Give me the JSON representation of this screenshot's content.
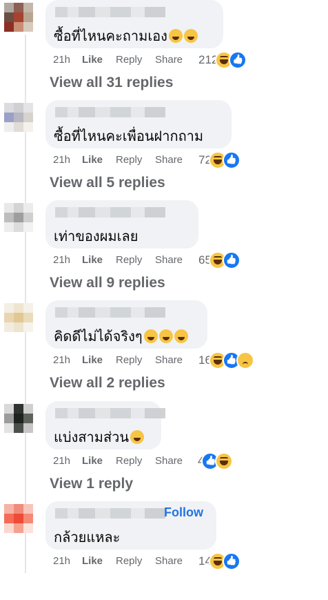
{
  "actions": {
    "time": "21h",
    "like": "Like",
    "reply": "Reply",
    "share": "Share"
  },
  "comments": [
    {
      "text": "ซื้อที่ไหนคะถามเอง",
      "emojis": [
        "laughing-crying-emoji",
        "shushing-emoji"
      ],
      "reaction_count": "212",
      "reactions": [
        "haha",
        "like"
      ],
      "replies": "View all 31 replies",
      "avatar_colors": [
        "#b0a9a2",
        "#8e5f54",
        "#c4b6a8",
        "#6b4d44",
        "#a7422f",
        "#b9a48f",
        "#8c2f24",
        "#c98f75",
        "#d8cbbd"
      ]
    },
    {
      "text": "ซื้อที่ไหนคะเพื่อนฝากถาม",
      "emojis": [],
      "reaction_count": "72",
      "reactions": [
        "haha",
        "like"
      ],
      "replies": "View all 5 replies",
      "avatar_colors": [
        "#dcdce0",
        "#cfcfd4",
        "#e4e4e7",
        "#9aa0c8",
        "#b7b6c2",
        "#d6d2cc",
        "#eeeeee",
        "#e1dcd6",
        "#f3f1ee"
      ]
    },
    {
      "text": "เท่าของผมเลย",
      "emojis": [],
      "reaction_count": "65",
      "reactions": [
        "haha",
        "like"
      ],
      "replies": "View all 9 replies",
      "avatar_colors": [
        "#e8e8e8",
        "#d4d4d4",
        "#ececec",
        "#bdbdbd",
        "#9e9e9e",
        "#cfcfcf",
        "#ededed",
        "#dcdcdc",
        "#f2f2f2"
      ]
    },
    {
      "text": "คิดดีไม่ได้จริงๆ",
      "emojis": [
        "thinking-face-emoji",
        "grinning-emoji",
        "rofl-emoji"
      ],
      "reaction_count": "16",
      "reactions": [
        "haha",
        "like",
        "sad"
      ],
      "replies": "View all 2 replies",
      "avatar_colors": [
        "#f4efe5",
        "#efe5cf",
        "#f5f1e8",
        "#e8d6b0",
        "#e1c893",
        "#eadbb9",
        "#f2ece0",
        "#ede3cf",
        "#f7f3ec"
      ]
    },
    {
      "text": "แบ่งสามส่วน",
      "emojis": [
        "grinning-sweat-emoji"
      ],
      "reaction_count": "4",
      "reactions": [
        "like",
        "haha"
      ],
      "replies": "View 1 reply",
      "avatar_colors": [
        "#d9d9d9",
        "#2f3430",
        "#cfcfcf",
        "#9c9c9c",
        "#1f231f",
        "#5d625b",
        "#e3e3e3",
        "#4c504b",
        "#c6c6c6"
      ]
    },
    {
      "text": "กล้วยแหละ",
      "emojis": [],
      "reaction_count": "14",
      "reactions": [
        "haha",
        "like"
      ],
      "replies": "",
      "follow": "Follow",
      "avatar_colors": [
        "#f6b3a6",
        "#f08c7b",
        "#f7c5bb",
        "#f46b57",
        "#ee4a36",
        "#f48a76",
        "#f9d8d0",
        "#f5a190",
        "#fbe3dc"
      ]
    }
  ]
}
